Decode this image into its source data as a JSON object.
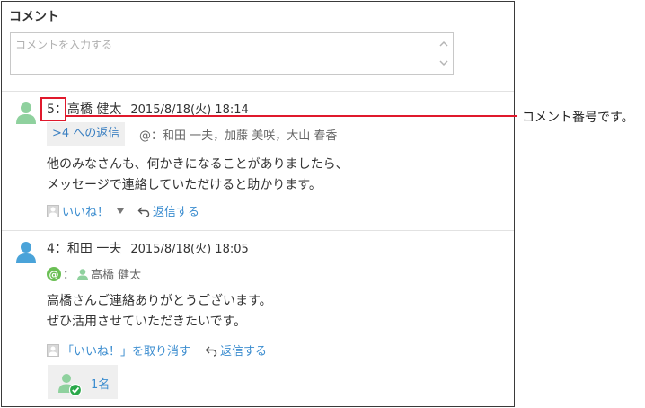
{
  "panel": {
    "title": "コメント",
    "placeholder": "コメントを入力する"
  },
  "comments": [
    {
      "number": "5",
      "separator": "：",
      "author": "高橋 健太",
      "date": "2015/8/18(火) 18:14",
      "reply_to": ">4 への返信",
      "mentions": "@：和田 一夫，加藤 美咲，大山 春香",
      "body_line1": "他のみなさんも、何かきになることがありましたら、",
      "body_line2": "メッセージで連絡していただけると助かります。",
      "like_label": "いいね！",
      "reply_label": "返信する"
    },
    {
      "number": "4",
      "separator": "：",
      "author": "和田 一夫",
      "date": "2015/8/18(火) 18:05",
      "mention_colon": "：",
      "mention_user": "高橋 健太",
      "body_line1": "高橋さんご連絡ありがとうございます。",
      "body_line2": "ぜひ活用させていただきたいです。",
      "unlike_label": "「いいね！」を取り消す",
      "reply_label": "返信する",
      "like_count": "1名"
    }
  ],
  "annotation": {
    "callout": "コメント番号です。"
  },
  "colors": {
    "highlight": "#e0192c",
    "link": "#3a8ccf",
    "avatar_green": "#8fd19e",
    "avatar_blue": "#4aa3d9"
  }
}
